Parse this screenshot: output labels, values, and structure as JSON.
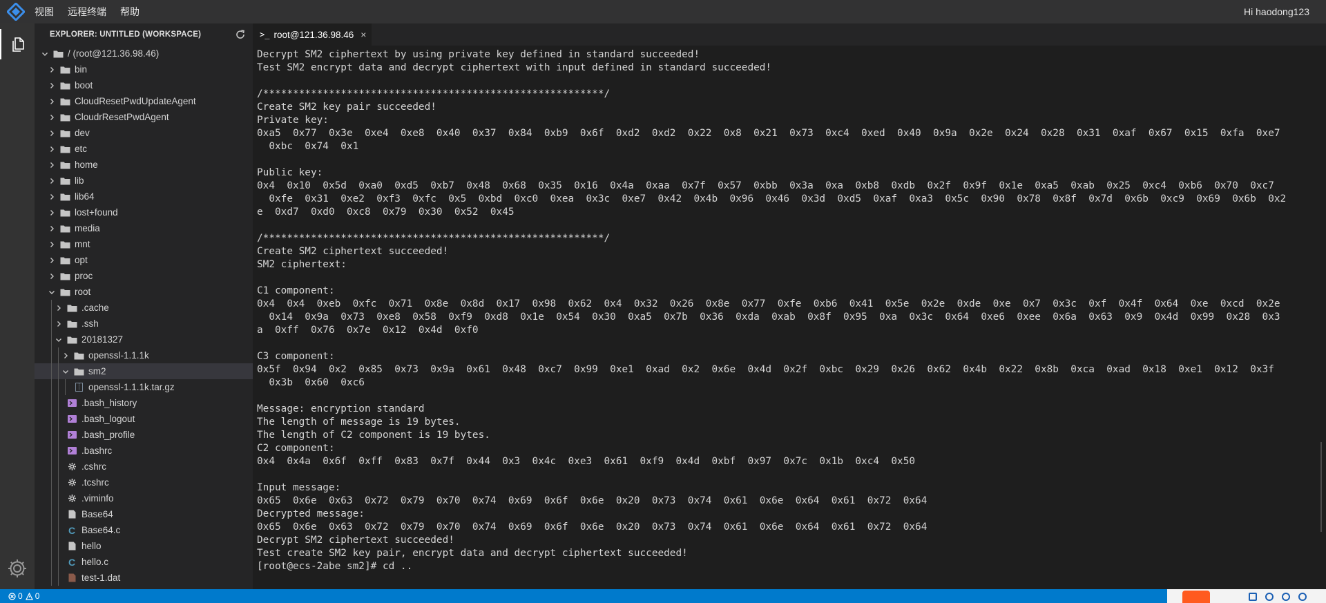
{
  "menu": {
    "items": [
      "视图",
      "远程终端",
      "帮助"
    ],
    "greeting": "Hi haodong123"
  },
  "sidebar": {
    "title": "EXPLORER: UNTITLED (WORKSPACE)",
    "tree": [
      {
        "label": "/ (root@121.36.98.46)",
        "depth": 0,
        "type": "folder",
        "expanded": true
      },
      {
        "label": "bin",
        "depth": 1,
        "type": "folder",
        "expanded": false
      },
      {
        "label": "boot",
        "depth": 1,
        "type": "folder",
        "expanded": false
      },
      {
        "label": "CloudResetPwdUpdateAgent",
        "depth": 1,
        "type": "folder",
        "expanded": false
      },
      {
        "label": "CloudrResetPwdAgent",
        "depth": 1,
        "type": "folder",
        "expanded": false
      },
      {
        "label": "dev",
        "depth": 1,
        "type": "folder",
        "expanded": false
      },
      {
        "label": "etc",
        "depth": 1,
        "type": "folder",
        "expanded": false
      },
      {
        "label": "home",
        "depth": 1,
        "type": "folder",
        "expanded": false
      },
      {
        "label": "lib",
        "depth": 1,
        "type": "folder",
        "expanded": false
      },
      {
        "label": "lib64",
        "depth": 1,
        "type": "folder",
        "expanded": false
      },
      {
        "label": "lost+found",
        "depth": 1,
        "type": "folder",
        "expanded": false
      },
      {
        "label": "media",
        "depth": 1,
        "type": "folder",
        "expanded": false
      },
      {
        "label": "mnt",
        "depth": 1,
        "type": "folder",
        "expanded": false
      },
      {
        "label": "opt",
        "depth": 1,
        "type": "folder",
        "expanded": false
      },
      {
        "label": "proc",
        "depth": 1,
        "type": "folder",
        "expanded": false
      },
      {
        "label": "root",
        "depth": 1,
        "type": "folder",
        "expanded": true
      },
      {
        "label": ".cache",
        "depth": 2,
        "type": "folder",
        "expanded": false
      },
      {
        "label": ".ssh",
        "depth": 2,
        "type": "folder",
        "expanded": false
      },
      {
        "label": "20181327",
        "depth": 2,
        "type": "folder",
        "expanded": true
      },
      {
        "label": "openssl-1.1.1k",
        "depth": 3,
        "type": "folder",
        "expanded": false
      },
      {
        "label": "sm2",
        "depth": 3,
        "type": "folder",
        "expanded": true,
        "selected": true
      },
      {
        "label": "openssl-1.1.1k.tar.gz",
        "depth": 3,
        "type": "archive"
      },
      {
        "label": ".bash_history",
        "depth": 2,
        "type": "shell"
      },
      {
        "label": ".bash_logout",
        "depth": 2,
        "type": "shell"
      },
      {
        "label": ".bash_profile",
        "depth": 2,
        "type": "shell"
      },
      {
        "label": ".bashrc",
        "depth": 2,
        "type": "shell"
      },
      {
        "label": ".cshrc",
        "depth": 2,
        "type": "gear"
      },
      {
        "label": ".tcshrc",
        "depth": 2,
        "type": "gear"
      },
      {
        "label": ".viminfo",
        "depth": 2,
        "type": "gear"
      },
      {
        "label": "Base64",
        "depth": 2,
        "type": "file"
      },
      {
        "label": "Base64.c",
        "depth": 2,
        "type": "c"
      },
      {
        "label": "hello",
        "depth": 2,
        "type": "file"
      },
      {
        "label": "hello.c",
        "depth": 2,
        "type": "c"
      },
      {
        "label": "test-1.dat",
        "depth": 2,
        "type": "dat"
      }
    ]
  },
  "tab": {
    "title": "root@121.36.98.46",
    "close": "×",
    "icon": ">_"
  },
  "terminal": {
    "lines": [
      "Decrypt SM2 ciphertext by using private key defined in standard succeeded!",
      "Test SM2 encrypt data and decrypt ciphertext with input defined in standard succeeded!",
      "",
      "/*********************************************************/",
      "Create SM2 key pair succeeded!",
      "Private key:",
      "0xa5  0x77  0x3e  0xe4  0xe8  0x40  0x37  0x84  0xb9  0x6f  0xd2  0xd2  0x22  0x8  0x21  0x73  0xc4  0xed  0x40  0x9a  0x2e  0x24  0x28  0x31  0xaf  0x67  0x15  0xfa  0xe7",
      "  0xbc  0x74  0x1",
      "",
      "Public key:",
      "0x4  0x10  0x5d  0xa0  0xd5  0xb7  0x48  0x68  0x35  0x16  0x4a  0xaa  0x7f  0x57  0xbb  0x3a  0xa  0xb8  0xdb  0x2f  0x9f  0x1e  0xa5  0xab  0x25  0xc4  0xb6  0x70  0xc7",
      "  0xfe  0x31  0xe2  0xf3  0xfc  0x5  0xbd  0xc0  0xea  0x3c  0xe7  0x42  0x4b  0x96  0x46  0x3d  0xd5  0xaf  0xa3  0x5c  0x90  0x78  0x8f  0x7d  0x6b  0xc9  0x69  0x6b  0x2",
      "e  0xd7  0xd0  0xc8  0x79  0x30  0x52  0x45",
      "",
      "/*********************************************************/",
      "Create SM2 ciphertext succeeded!",
      "SM2 ciphertext:",
      "",
      "C1 component:",
      "0x4  0x4  0xeb  0xfc  0x71  0x8e  0x8d  0x17  0x98  0x62  0x4  0x32  0x26  0x8e  0x77  0xfe  0xb6  0x41  0x5e  0x2e  0xde  0xe  0x7  0x3c  0xf  0x4f  0x64  0xe  0xcd  0x2e",
      "  0x14  0x9a  0x73  0xe8  0x58  0xf9  0xd8  0x1e  0x54  0x30  0xa5  0x7b  0x36  0xda  0xab  0x8f  0x95  0xa  0x3c  0x64  0xe6  0xee  0x6a  0x63  0x9  0x4d  0x99  0x28  0x3",
      "a  0xff  0x76  0x7e  0x12  0x4d  0xf0",
      "",
      "C3 component:",
      "0x5f  0x94  0x2  0x85  0x73  0x9a  0x61  0x48  0xc7  0x99  0xe1  0xad  0x2  0x6e  0x4d  0x2f  0xbc  0x29  0x26  0x62  0x4b  0x22  0x8b  0xca  0xad  0x18  0xe1  0x12  0x3f",
      "  0x3b  0x60  0xc6",
      "",
      "Message: encryption standard",
      "The length of message is 19 bytes.",
      "The length of C2 component is 19 bytes.",
      "C2 component:",
      "0x4  0x4a  0x6f  0xff  0x83  0x7f  0x44  0x3  0x4c  0xe3  0x61  0xf9  0x4d  0xbf  0x97  0x7c  0x1b  0xc4  0x50",
      "",
      "Input message:",
      "0x65  0x6e  0x63  0x72  0x79  0x70  0x74  0x69  0x6f  0x6e  0x20  0x73  0x74  0x61  0x6e  0x64  0x61  0x72  0x64",
      "Decrypted message:",
      "0x65  0x6e  0x63  0x72  0x79  0x70  0x74  0x69  0x6f  0x6e  0x20  0x73  0x74  0x61  0x6e  0x64  0x61  0x72  0x64",
      "Decrypt SM2 ciphertext succeeded!",
      "Test create SM2 key pair, encrypt data and decrypt ciphertext succeeded!",
      "[root@ecs-2abe sm2]# cd .."
    ]
  },
  "status": {
    "errors": "0",
    "warnings": "0"
  },
  "colors": {
    "accent": "#007acc",
    "folder": "#c5c5c5",
    "shell": "#b180d7",
    "c": "#519aba",
    "titlebar": "#323233"
  }
}
